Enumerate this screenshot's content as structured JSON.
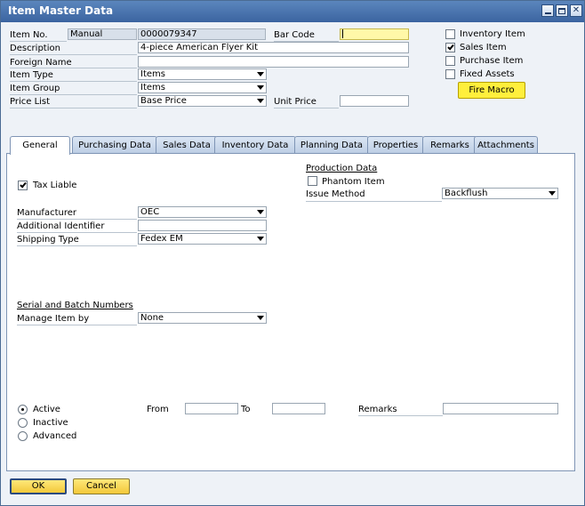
{
  "window": {
    "title": "Item Master Data",
    "controls": [
      "minimize",
      "maximize",
      "close"
    ]
  },
  "header": {
    "item_no_label": "Item No.",
    "numbering_series": "Manual",
    "item_no_value": "0000079347",
    "barcode_label": "Bar Code",
    "barcode_value": "",
    "description_label": "Description",
    "description_value": "4-piece American Flyer Kit",
    "foreign_name_label": "Foreign Name",
    "foreign_name_value": "",
    "item_type_label": "Item Type",
    "item_type_value": "Items",
    "item_group_label": "Item Group",
    "item_group_value": "Items",
    "price_list_label": "Price List",
    "price_list_value": "Base Price",
    "unit_price_label": "Unit Price",
    "unit_price_value": ""
  },
  "flags": {
    "inventory_item": {
      "label": "Inventory Item",
      "checked": false
    },
    "sales_item": {
      "label": "Sales Item",
      "checked": true
    },
    "purchase_item": {
      "label": "Purchase Item",
      "checked": false
    },
    "fixed_assets": {
      "label": "Fixed Assets",
      "checked": false
    },
    "fire_macro_label": "Fire Macro"
  },
  "tabs": [
    {
      "label": "General",
      "active": true
    },
    {
      "label": "Purchasing Data",
      "active": false
    },
    {
      "label": "Sales Data",
      "active": false
    },
    {
      "label": "Inventory Data",
      "active": false
    },
    {
      "label": "Planning Data",
      "active": false
    },
    {
      "label": "Properties",
      "active": false
    },
    {
      "label": "Remarks",
      "active": false
    },
    {
      "label": "Attachments",
      "active": false
    }
  ],
  "general": {
    "tax_liable": {
      "label": "Tax Liable",
      "checked": true
    },
    "production": {
      "title": "Production Data",
      "phantom_item_label": "Phantom Item",
      "phantom_item_checked": false,
      "issue_method_label": "Issue Method",
      "issue_method_value": "Backflush"
    },
    "manufacturer_label": "Manufacturer",
    "manufacturer_value": "OEC",
    "additional_identifier_label": "Additional Identifier",
    "additional_identifier_value": "",
    "shipping_type_label": "Shipping Type",
    "shipping_type_value": "Fedex EM",
    "serial_batch_title": "Serial and Batch Numbers",
    "manage_item_by_label": "Manage Item by",
    "manage_item_by_value": "None",
    "status": {
      "options": [
        "Active",
        "Inactive",
        "Advanced"
      ],
      "selected": "Active"
    },
    "from_label": "From",
    "from_value": "",
    "to_label": "To",
    "to_value": "",
    "remarks_label": "Remarks",
    "remarks_value": ""
  },
  "footer": {
    "ok_label": "OK",
    "cancel_label": "Cancel"
  },
  "colors": {
    "titlebar": "#3b64a0",
    "highlight_yellow": "#ffef3c",
    "window_bg": "#eef2f7"
  }
}
